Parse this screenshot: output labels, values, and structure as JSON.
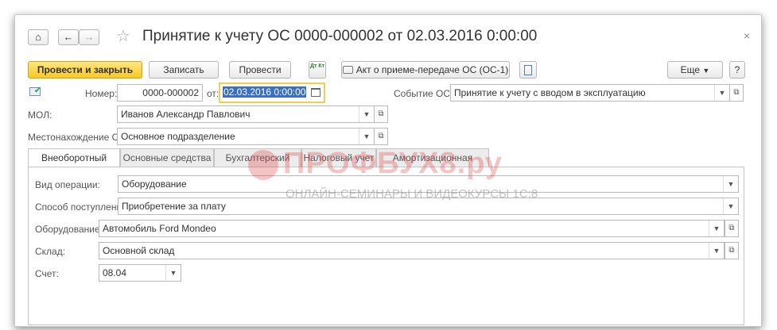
{
  "window": {
    "title": "Принятие к учету ОС 0000-000002 от 02.03.2016 0:00:00",
    "close": "×"
  },
  "nav": {
    "home": "⌂",
    "back": "←",
    "forward": "→",
    "star": "☆"
  },
  "toolbar": {
    "post_close": "Провести и закрыть",
    "save": "Записать",
    "post": "Провести",
    "dtkt": "Дт Кт",
    "act": "Акт о приеме-передаче ОС (ОС-1)",
    "more": "Еще",
    "help": "?"
  },
  "header": {
    "number_label": "Номер:",
    "number_value": "0000-000002",
    "date_label": "от:",
    "date_value": "02.03.2016  0:00:00",
    "event_label": "Событие ОС:",
    "event_value": "Принятие к учету с вводом в эксплуатацию",
    "mol_label": "МОЛ:",
    "mol_value": "Иванов Александр Павлович",
    "location_label": "Местонахождение ОС:",
    "location_value": "Основное подразделение"
  },
  "tabs": [
    "Внеоборотный актив",
    "Основные средства",
    "Бухгалтерский учет",
    "Налоговый учет",
    "Амортизационная премия"
  ],
  "panel": {
    "operation_label": "Вид операции:",
    "operation_value": "Оборудование",
    "receipt_label": "Способ поступления:",
    "receipt_value": "Приобретение за плату",
    "equipment_label": "Оборудование:",
    "equipment_value": "Автомобиль Ford Mondeo",
    "warehouse_label": "Склад:",
    "warehouse_value": "Основной склад",
    "account_label": "Счет:",
    "account_value": "08.04"
  },
  "watermark": {
    "brand": "ПРОФБУХ8.ру",
    "tagline": "ОНЛАЙН-СЕМИНАРЫ И ВИДЕОКУРСЫ 1С:8"
  },
  "colors": {
    "primary_button": "#f7c927",
    "date_highlight": "#3a6fc4",
    "watermark": "#dc4646"
  }
}
